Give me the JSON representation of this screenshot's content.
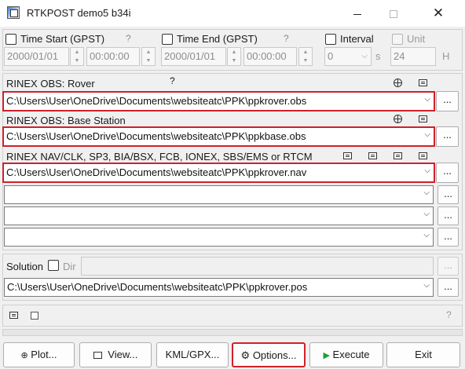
{
  "window": {
    "title": "RTKPOST demo5 b34i",
    "min_icon": "minimize-icon",
    "max_icon": "maximize-icon",
    "close_glyph": "✕"
  },
  "time": {
    "start_label": "Time Start (GPST)",
    "start_help": "?",
    "start_date": "2000/01/01",
    "start_time": "00:00:00",
    "end_label": "Time End (GPST)",
    "end_help": "?",
    "end_date": "2000/01/01",
    "end_time": "00:00:00",
    "interval_label": "Interval",
    "interval_value": "0",
    "interval_unit": "s",
    "unit_label": "Unit",
    "unit_value": "24",
    "unit_unit": "H"
  },
  "inputs": {
    "rover_label": "RINEX OBS: Rover",
    "rover_help": "?",
    "rover_path": "C:\\Users\\User\\OneDrive\\Documents\\websiteatc\\PPK\\ppkrover.obs",
    "base_label": "RINEX OBS: Base Station",
    "base_path": "C:\\Users\\User\\OneDrive\\Documents\\websiteatc\\PPK\\ppkbase.obs",
    "nav_label": "RINEX NAV/CLK, SP3, BIA/BSX, FCB, IONEX, SBS/EMS  or RTCM",
    "nav_path": "C:\\Users\\User\\OneDrive\\Documents\\websiteatc\\PPK\\ppkrover.nav",
    "extra_paths": [
      "",
      "",
      ""
    ],
    "browse_label": "..."
  },
  "solution": {
    "label": "Solution",
    "dir_label": "Dir",
    "dir_value": "",
    "path": "C:\\Users\\User\\OneDrive\\Documents\\websiteatc\\PPK\\ppkrover.pos",
    "browse_label": "..."
  },
  "status": {
    "help": "?",
    "progress": 0
  },
  "buttons": {
    "plot": "Plot...",
    "view": "View...",
    "kml": "KML/GPX...",
    "options": "Options...",
    "execute": "Execute",
    "exit": "Exit"
  },
  "colors": {
    "highlight_frame": "#d1202a",
    "execute_icon": "#1e9e3a"
  }
}
